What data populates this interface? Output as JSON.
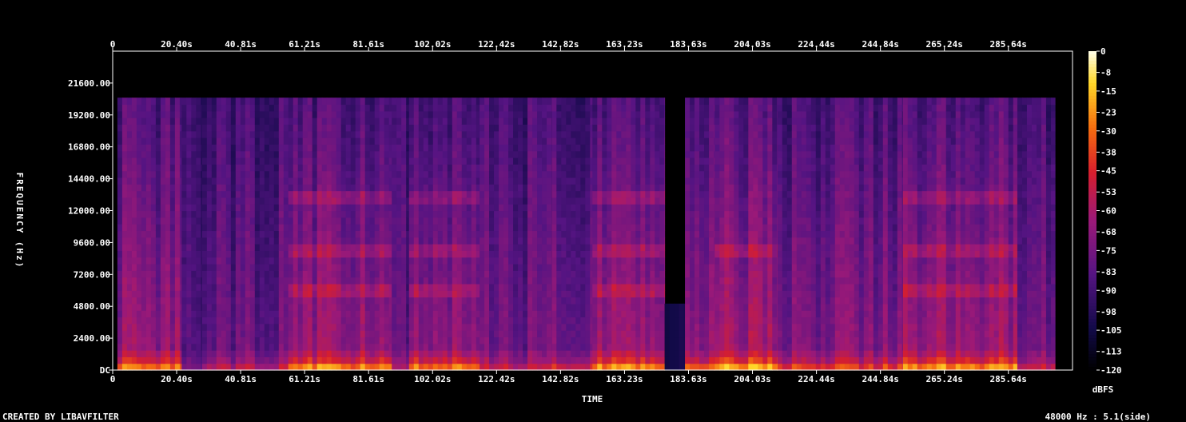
{
  "footer": {
    "credit": "CREATED BY LIBAVFILTER",
    "info": "48000 Hz : 5.1(side)"
  },
  "colors": {
    "background": "#000000",
    "frame": "#ffffff",
    "text": "#ffffff"
  },
  "chart_data": {
    "type": "heatmap",
    "title": "",
    "xlabel": "TIME",
    "ylabel": "FREQUENCY (Hz)",
    "colorbar_label": "dBFS",
    "x_ticks": [
      "0",
      "20.40s",
      "40.81s",
      "61.21s",
      "81.61s",
      "102.02s",
      "122.42s",
      "142.82s",
      "163.23s",
      "183.63s",
      "204.03s",
      "224.44s",
      "244.84s",
      "265.24s",
      "285.64s"
    ],
    "x_tick_values": [
      0,
      20.4,
      40.81,
      61.21,
      81.61,
      102.02,
      122.42,
      142.82,
      163.23,
      183.63,
      204.03,
      224.44,
      244.84,
      265.24,
      285.64
    ],
    "xlim": [
      0,
      306.1
    ],
    "y_ticks": [
      "DC",
      "2400.00",
      "4800.00",
      "7200.00",
      "9600.00",
      "12000.00",
      "14400.00",
      "16800.00",
      "19200.00",
      "21600.00"
    ],
    "y_tick_values": [
      0,
      2400,
      4800,
      7200,
      9600,
      12000,
      14400,
      16800,
      19200,
      21600
    ],
    "ylim": [
      0,
      24000
    ],
    "colorbar_ticks": [
      "0",
      "-8",
      "-15",
      "-23",
      "-30",
      "-38",
      "-45",
      "-53",
      "-60",
      "-68",
      "-75",
      "-83",
      "-90",
      "-98",
      "-105",
      "-113",
      "-120"
    ],
    "colorbar_range": [
      -120,
      0
    ],
    "content_cutoff_hz": 20500,
    "segments": [
      {
        "start": 1.5,
        "end": 22.0,
        "level": 0.75
      },
      {
        "start": 22.0,
        "end": 28.5,
        "level": 0.22
      },
      {
        "start": 28.5,
        "end": 56.0,
        "level": 0.45
      },
      {
        "start": 56.0,
        "end": 89.0,
        "level": 0.8,
        "bands_hz": [
          6000,
          9000,
          13000
        ]
      },
      {
        "start": 89.0,
        "end": 94.5,
        "level": 0.4
      },
      {
        "start": 94.5,
        "end": 117.0,
        "level": 0.8,
        "bands_hz": [
          6000,
          9000,
          13000
        ]
      },
      {
        "start": 117.0,
        "end": 140.0,
        "level": 0.48
      },
      {
        "start": 140.0,
        "end": 153.0,
        "level": 0.55
      },
      {
        "start": 153.0,
        "end": 176.0,
        "level": 0.82,
        "bands_hz": [
          6000,
          9000,
          13000
        ]
      },
      {
        "start": 176.0,
        "end": 182.5,
        "level": 0.1,
        "ceiling_hz": 5000
      },
      {
        "start": 182.5,
        "end": 192.0,
        "level": 0.7
      },
      {
        "start": 192.0,
        "end": 212.0,
        "level": 0.85,
        "bands_hz": [
          9000
        ]
      },
      {
        "start": 212.0,
        "end": 252.0,
        "level": 0.62
      },
      {
        "start": 252.0,
        "end": 288.5,
        "level": 0.82,
        "bands_hz": [
          6000,
          9000,
          13000
        ]
      },
      {
        "start": 288.5,
        "end": 300.5,
        "level": 0.5
      }
    ]
  }
}
